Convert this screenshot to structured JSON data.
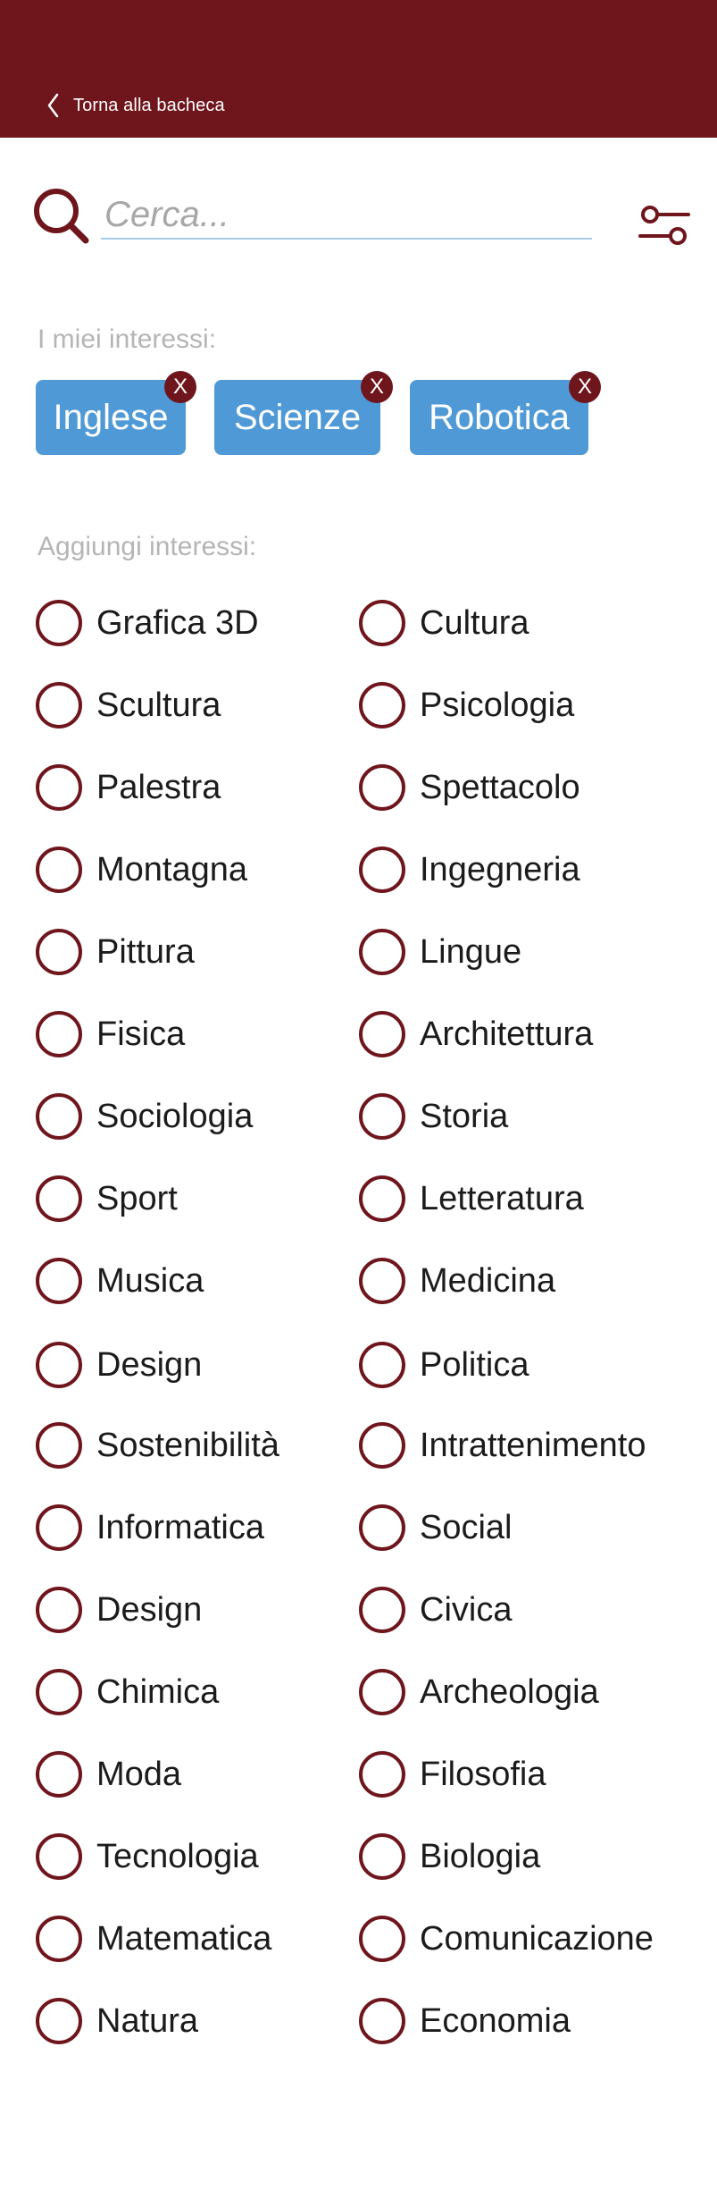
{
  "header": {
    "back_label": "Torna alla bacheca",
    "background_color": "#6f161d"
  },
  "search": {
    "placeholder": "Cerca...",
    "value": ""
  },
  "interests": {
    "label": "I miei interessi:",
    "remove_symbol": "X",
    "tags": [
      {
        "label": "Inglese"
      },
      {
        "label": "Scienze"
      },
      {
        "label": "Robotica"
      }
    ]
  },
  "add_interests": {
    "label": "Aggiungi interessi:",
    "options": [
      {
        "label": "Grafica 3D",
        "selected": false
      },
      {
        "label": "Cultura",
        "selected": false
      },
      {
        "label": "Scultura",
        "selected": false
      },
      {
        "label": "Psicologia",
        "selected": false
      },
      {
        "label": "Palestra",
        "selected": false
      },
      {
        "label": "Spettacolo",
        "selected": false
      },
      {
        "label": "Montagna",
        "selected": false
      },
      {
        "label": "Ingegneria",
        "selected": false
      },
      {
        "label": "Pittura",
        "selected": false
      },
      {
        "label": "Lingue",
        "selected": false
      },
      {
        "label": "Fisica",
        "selected": false
      },
      {
        "label": "Architettura",
        "selected": false
      },
      {
        "label": "Sociologia",
        "selected": false
      },
      {
        "label": "Storia",
        "selected": false
      },
      {
        "label": "Sport",
        "selected": false
      },
      {
        "label": "Letteratura",
        "selected": false
      },
      {
        "label": "Musica",
        "selected": false
      },
      {
        "label": "Medicina",
        "selected": false
      },
      {
        "label": "Design",
        "selected": false
      },
      {
        "label": "Politica",
        "selected": false
      },
      {
        "label": "Sostenibilità",
        "selected": false
      },
      {
        "label": "Intrattenimento",
        "selected": false
      },
      {
        "label": "Informatica",
        "selected": false
      },
      {
        "label": "Social",
        "selected": false
      },
      {
        "label": "Design",
        "selected": false
      },
      {
        "label": "Civica",
        "selected": false
      },
      {
        "label": "Chimica",
        "selected": false
      },
      {
        "label": "Archeologia",
        "selected": false
      },
      {
        "label": "Moda",
        "selected": false
      },
      {
        "label": "Filosofia",
        "selected": false
      },
      {
        "label": "Tecnologia",
        "selected": false
      },
      {
        "label": "Biologia",
        "selected": false
      },
      {
        "label": "Matematica",
        "selected": false
      },
      {
        "label": "Comunicazione",
        "selected": false
      },
      {
        "label": "Natura",
        "selected": false
      },
      {
        "label": "Economia",
        "selected": false
      }
    ]
  },
  "colors": {
    "accent": "#6f161d",
    "tag": "#4f9ad6",
    "muted_text": "#b5b5b5",
    "search_underline": "#a9cce8"
  },
  "icons": {
    "back": "chevron-left-icon",
    "search": "search-icon",
    "filter": "filter-icon",
    "remove": "close-icon"
  }
}
